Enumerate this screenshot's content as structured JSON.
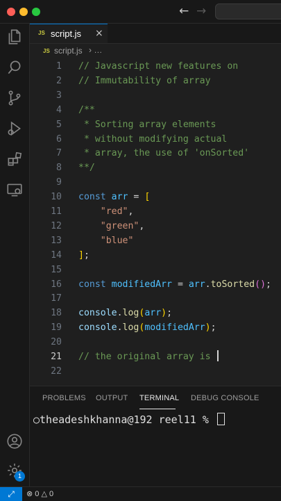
{
  "tab": {
    "icon_label": "JS",
    "label": "script.js",
    "close": "×"
  },
  "breadcrumb": {
    "icon_label": "JS",
    "file": "script.js",
    "separator": "›",
    "more": "…"
  },
  "code": [
    {
      "n": "1",
      "tokens": [
        {
          "t": "// Javascript new features on",
          "c": "comment"
        }
      ]
    },
    {
      "n": "2",
      "tokens": [
        {
          "t": "// Immutability of array",
          "c": "comment"
        }
      ]
    },
    {
      "n": "3",
      "tokens": []
    },
    {
      "n": "4",
      "tokens": [
        {
          "t": "/**",
          "c": "comment"
        }
      ]
    },
    {
      "n": "5",
      "tokens": [
        {
          "t": " * Sorting array elements",
          "c": "comment"
        }
      ]
    },
    {
      "n": "6",
      "tokens": [
        {
          "t": " * without modifying actual",
          "c": "comment"
        }
      ]
    },
    {
      "n": "7",
      "tokens": [
        {
          "t": " * array, the use of 'onSorted'",
          "c": "comment"
        }
      ]
    },
    {
      "n": "8",
      "tokens": [
        {
          "t": "**/",
          "c": "comment"
        }
      ]
    },
    {
      "n": "9",
      "tokens": []
    },
    {
      "n": "10",
      "tokens": [
        {
          "t": "const",
          "c": "kw"
        },
        {
          "t": " ",
          "c": "plain"
        },
        {
          "t": "arr",
          "c": "const"
        },
        {
          "t": " = ",
          "c": "plain"
        },
        {
          "t": "[",
          "c": "bracket1"
        }
      ]
    },
    {
      "n": "11",
      "tokens": [
        {
          "t": "    ",
          "c": "plain"
        },
        {
          "t": "\"red\"",
          "c": "str"
        },
        {
          "t": ",",
          "c": "plain"
        }
      ]
    },
    {
      "n": "12",
      "tokens": [
        {
          "t": "    ",
          "c": "plain"
        },
        {
          "t": "\"green\"",
          "c": "str"
        },
        {
          "t": ",",
          "c": "plain"
        }
      ]
    },
    {
      "n": "13",
      "tokens": [
        {
          "t": "    ",
          "c": "plain"
        },
        {
          "t": "\"blue\"",
          "c": "str"
        }
      ]
    },
    {
      "n": "14",
      "tokens": [
        {
          "t": "]",
          "c": "bracket1"
        },
        {
          "t": ";",
          "c": "plain"
        }
      ]
    },
    {
      "n": "15",
      "tokens": []
    },
    {
      "n": "16",
      "tokens": [
        {
          "t": "const",
          "c": "kw"
        },
        {
          "t": " ",
          "c": "plain"
        },
        {
          "t": "modifiedArr",
          "c": "const"
        },
        {
          "t": " = ",
          "c": "plain"
        },
        {
          "t": "arr",
          "c": "const"
        },
        {
          "t": ".",
          "c": "plain"
        },
        {
          "t": "toSorted",
          "c": "fn"
        },
        {
          "t": "()",
          "c": "bracket2"
        },
        {
          "t": ";",
          "c": "plain"
        }
      ]
    },
    {
      "n": "17",
      "tokens": []
    },
    {
      "n": "18",
      "tokens": [
        {
          "t": "console",
          "c": "var"
        },
        {
          "t": ".",
          "c": "plain"
        },
        {
          "t": "log",
          "c": "fn"
        },
        {
          "t": "(",
          "c": "bracket1"
        },
        {
          "t": "arr",
          "c": "const"
        },
        {
          "t": ")",
          "c": "bracket1"
        },
        {
          "t": ";",
          "c": "plain"
        }
      ]
    },
    {
      "n": "19",
      "tokens": [
        {
          "t": "console",
          "c": "var"
        },
        {
          "t": ".",
          "c": "plain"
        },
        {
          "t": "log",
          "c": "fn"
        },
        {
          "t": "(",
          "c": "bracket1"
        },
        {
          "t": "modifiedArr",
          "c": "const"
        },
        {
          "t": ")",
          "c": "bracket1"
        },
        {
          "t": ";",
          "c": "plain"
        }
      ]
    },
    {
      "n": "20",
      "tokens": []
    },
    {
      "n": "21",
      "tokens": [
        {
          "t": "// the original array is ",
          "c": "comment"
        }
      ],
      "active": true,
      "cursor": true
    },
    {
      "n": "22",
      "tokens": []
    }
  ],
  "panel": {
    "tabs": [
      "PROBLEMS",
      "OUTPUT",
      "TERMINAL",
      "DEBUG CONSOLE"
    ],
    "active_tab": "TERMINAL",
    "terminal_prompt": "theadeshkhanna@192 reel11 % ",
    "prompt_marker": "○"
  },
  "status": {
    "remote_icon": "⤢",
    "errors": "0",
    "warnings": "0"
  },
  "accounts_badge": "1",
  "nav": {
    "back": "←",
    "forward": "→"
  },
  "colors": {
    "accent": "#0078d4",
    "comment": "#6a9955",
    "keyword": "#569cd6",
    "string": "#ce9178",
    "function": "#dcdcaa"
  },
  "icons": [
    "explorer-icon",
    "search-icon",
    "source-control-icon",
    "run-debug-icon",
    "extensions-icon",
    "remote-explorer-icon",
    "account-icon",
    "settings-gear-icon"
  ]
}
